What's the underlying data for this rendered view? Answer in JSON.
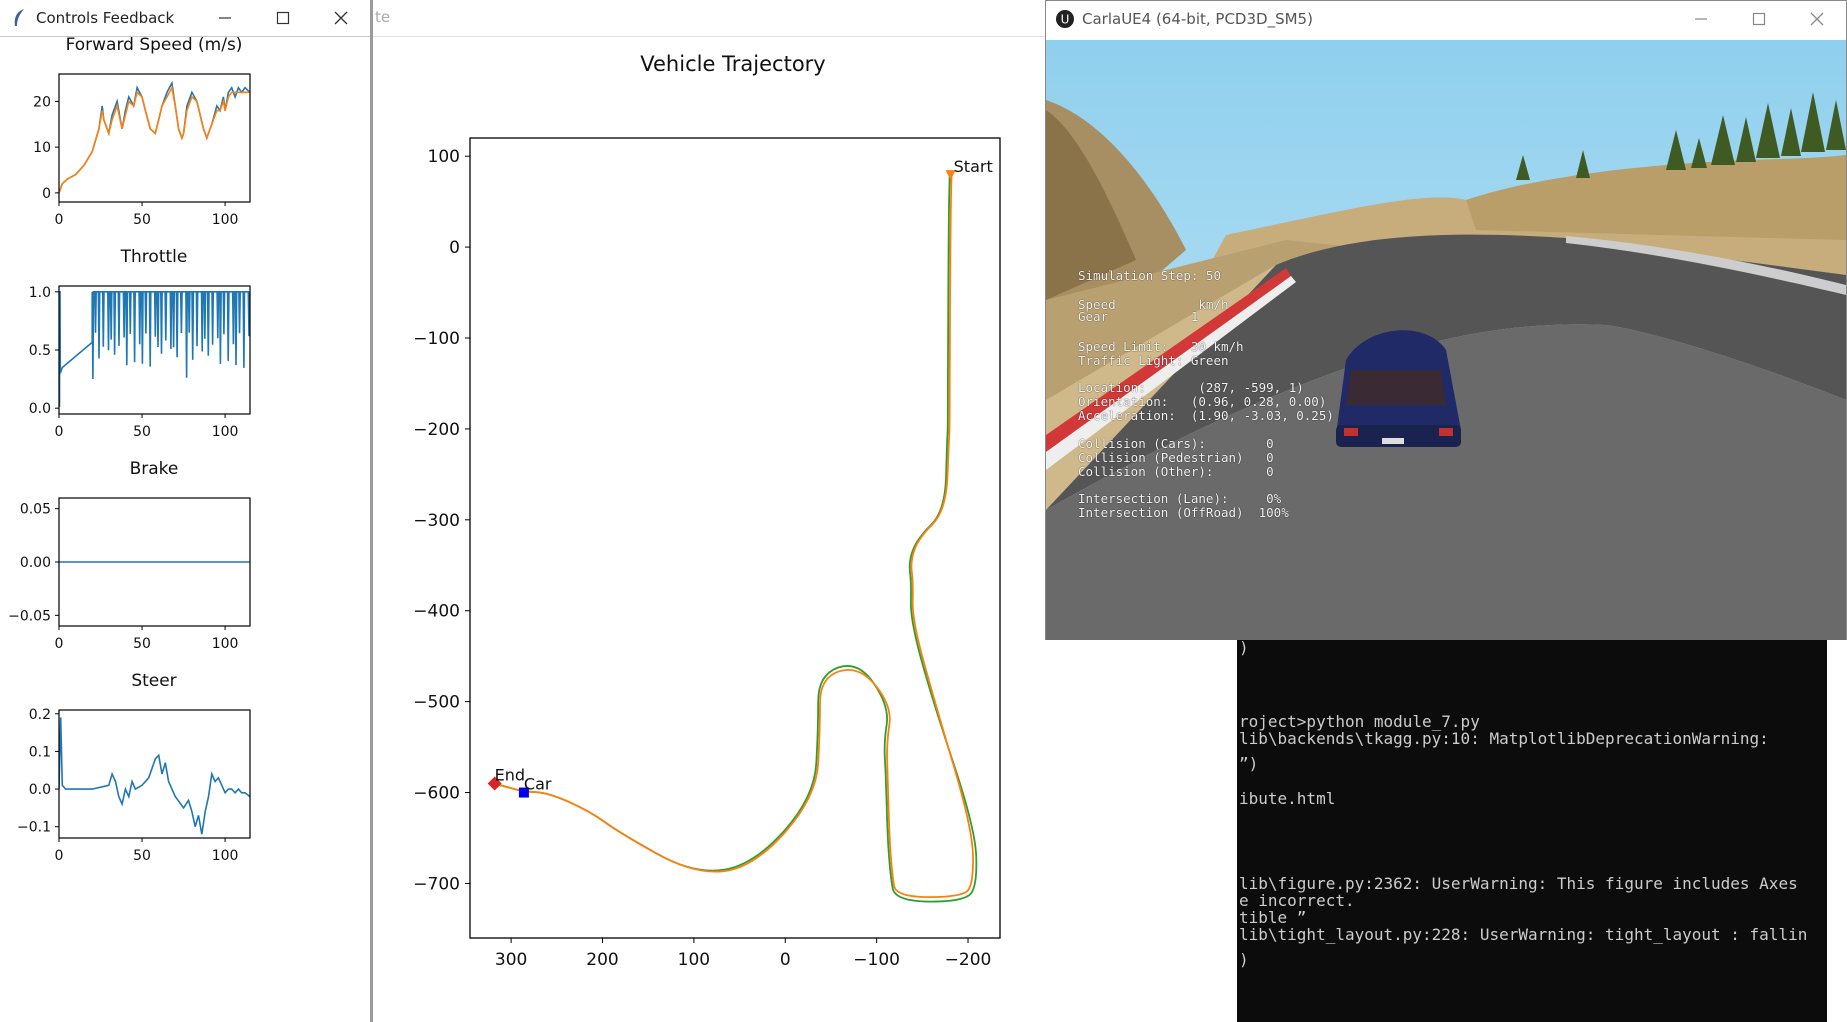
{
  "controls_window": {
    "title": "Controls Feedback",
    "icon": "feather-icon",
    "plots": [
      {
        "title": "Forward Speed (m/s)",
        "yticks": [
          "20",
          "10",
          "0"
        ],
        "xticks": [
          "0",
          "50",
          "100"
        ]
      },
      {
        "title": "Throttle",
        "yticks": [
          "1.0",
          "0.5",
          "0.0"
        ],
        "xticks": [
          "0",
          "50",
          "100"
        ]
      },
      {
        "title": "Brake",
        "yticks": [
          "0.05",
          "0.00",
          "−0.05"
        ],
        "xticks": [
          "0",
          "50",
          "100"
        ]
      },
      {
        "title": "Steer",
        "yticks": [
          "0.2",
          "0.1",
          "0.0",
          "−0.1"
        ],
        "xticks": [
          "0",
          "50",
          "100"
        ]
      }
    ]
  },
  "trajectory_window": {
    "hidden_title_fragment": "te",
    "title": "Vehicle Trajectory",
    "start_label": "Start",
    "end_label": "End",
    "car_label": "Car",
    "yticks": [
      "100",
      "0",
      "−100",
      "−200",
      "−300",
      "−400",
      "−500",
      "−600",
      "−700"
    ],
    "xticks": [
      "300",
      "200",
      "100",
      "0",
      "−100",
      "−200"
    ]
  },
  "carla_window": {
    "title": "CarlaUE4 (64-bit, PCD3D_SM5)",
    "icon": "unreal-engine-icon",
    "hud": [
      "Simulation Step: 50",
      "Speed           km/h",
      "Gear           1",
      "Speed Limit:   30 km/h",
      "Traffic Light: Green",
      "Location:       (287, -599, 1)",
      "Orientation:   (0.96, 0.28, 0.00)",
      "Acceleration:  (1.90, -3.03, 0.25)",
      "Collision (Cars):        0",
      "Collision (Pedestrian)   0",
      "Collision (Other):       0",
      "Intersection (Lane):     0%",
      "Intersection (OffRoad)  100%"
    ]
  },
  "terminal": {
    "lines": [
      ")",
      "roject>python module_7.py",
      "lib\\backends\\tkagg.py:10: MatplotlibDeprecationWarning:",
      "”)",
      "ibute.html",
      "lib\\figure.py:2362: UserWarning: This figure includes Axes",
      "e incorrect.",
      "tible ”",
      "lib\\tight_layout.py:228: UserWarning: tight_layout : fallin",
      ")"
    ]
  },
  "chart_data": [
    {
      "type": "line",
      "title": "Forward Speed (m/s)",
      "xlim": [
        0,
        115
      ],
      "ylim": [
        -2,
        26
      ],
      "series": [
        {
          "color": "#1f77b4",
          "x": [
            0,
            2,
            5,
            10,
            15,
            20,
            24,
            26,
            27,
            30,
            32,
            35,
            38,
            40,
            42,
            45,
            47,
            50,
            52,
            55,
            58,
            60,
            62,
            65,
            68,
            70,
            72,
            74,
            75,
            77,
            80,
            83,
            85,
            87,
            89,
            92,
            95,
            97,
            99,
            100,
            102,
            104,
            106,
            108,
            110,
            112,
            115
          ],
          "y": [
            0,
            2,
            3,
            4,
            6,
            9,
            14,
            19,
            16,
            13,
            17,
            20,
            14,
            18,
            21,
            19,
            23,
            21,
            18,
            14,
            13,
            16,
            19,
            22,
            24,
            19,
            14,
            12,
            13,
            19,
            22,
            20,
            17,
            14,
            12,
            15,
            19,
            18,
            21,
            18,
            22,
            23,
            21,
            23,
            22,
            23,
            22
          ]
        },
        {
          "color": "#ff7f0e",
          "x": [
            0,
            2,
            5,
            10,
            15,
            20,
            24,
            26,
            27,
            30,
            32,
            35,
            38,
            40,
            42,
            45,
            47,
            50,
            52,
            55,
            58,
            60,
            62,
            65,
            68,
            70,
            72,
            74,
            75,
            77,
            80,
            83,
            85,
            87,
            89,
            92,
            95,
            97,
            99,
            100,
            102,
            104,
            106,
            108,
            110,
            112,
            115
          ],
          "y": [
            0,
            2,
            3,
            4,
            6,
            9,
            14,
            18,
            16,
            13,
            16,
            19,
            14,
            17,
            20,
            19,
            22,
            21,
            18,
            14,
            13,
            16,
            19,
            21,
            23,
            19,
            14,
            12,
            13,
            18,
            21,
            20,
            17,
            14,
            12,
            15,
            18,
            18,
            20,
            18,
            21,
            22,
            22,
            22,
            22,
            22,
            22
          ]
        }
      ]
    },
    {
      "type": "line",
      "title": "Throttle",
      "xlim": [
        0,
        115
      ],
      "ylim": [
        -0.05,
        1.05
      ],
      "series": [
        {
          "color": "#1f77b4",
          "pattern": "throttle",
          "x": [
            0,
            115
          ],
          "y": [
            0,
            1
          ]
        }
      ]
    },
    {
      "type": "line",
      "title": "Brake",
      "xlim": [
        0,
        115
      ],
      "ylim": [
        -0.06,
        0.06
      ],
      "series": [
        {
          "color": "#1f77b4",
          "x": [
            0,
            115
          ],
          "y": [
            0,
            0
          ]
        }
      ]
    },
    {
      "type": "line",
      "title": "Steer",
      "xlim": [
        0,
        115
      ],
      "ylim": [
        -0.13,
        0.21
      ],
      "series": [
        {
          "color": "#1f77b4",
          "x": [
            0,
            1,
            2,
            4,
            10,
            20,
            30,
            32,
            34,
            36,
            38,
            40,
            42,
            44,
            46,
            50,
            54,
            58,
            60,
            62,
            64,
            66,
            70,
            75,
            78,
            80,
            82,
            84,
            86,
            88,
            90,
            92,
            94,
            96,
            98,
            100,
            102,
            104,
            106,
            108,
            110,
            112,
            115
          ],
          "y": [
            0,
            0.19,
            0.01,
            0.0,
            0.0,
            0.0,
            0.01,
            0.04,
            0.02,
            -0.02,
            -0.04,
            0.0,
            -0.02,
            0.02,
            0.0,
            0.01,
            0.03,
            0.08,
            0.09,
            0.04,
            0.07,
            0.02,
            -0.02,
            -0.05,
            -0.03,
            -0.06,
            -0.1,
            -0.07,
            -0.12,
            -0.06,
            -0.02,
            0.04,
            0.02,
            0.03,
            0.01,
            -0.01,
            0.0,
            0.0,
            -0.01,
            0.0,
            -0.01,
            -0.01,
            -0.02
          ]
        }
      ]
    },
    {
      "type": "line",
      "title": "Vehicle Trajectory",
      "xlim": [
        345,
        -235
      ],
      "ylim": [
        -760,
        120
      ],
      "series": [
        {
          "color": "#2ca02c",
          "x": [
            -180,
            -179,
            -178,
            -178,
            -177,
            -175,
            -145,
            -135,
            -138,
            -137,
            -160,
            -208,
            -210,
            -198,
            -120,
            -115,
            -112,
            -110,
            -108,
            -114,
            -80,
            -36,
            -36,
            -32,
            35,
            100,
            180,
            215,
            260,
            287,
            300,
            320
          ],
          "y": [
            80,
            40,
            -100,
            -200,
            -213,
            -290,
            -320,
            -345,
            -370,
            -410,
            -495,
            -640,
            -700,
            -720,
            -720,
            -690,
            -650,
            -580,
            -545,
            -505,
            -455,
            -470,
            -530,
            -605,
            -680,
            -690,
            -645,
            -620,
            -600,
            -599,
            -595,
            -590
          ]
        },
        {
          "color": "#ff7f0e",
          "x": [
            -182,
            -181,
            -180,
            -180,
            -179,
            -176,
            -146,
            -137,
            -140,
            -139,
            -162,
            -205,
            -206,
            -194,
            -121,
            -117,
            -114,
            -112,
            -111,
            -117,
            -81,
            -38,
            -38,
            -34,
            35,
            100,
            180,
            215,
            260,
            287,
            300,
            320
          ],
          "y": [
            80,
            40,
            -100,
            -200,
            -213,
            -290,
            -320,
            -345,
            -370,
            -410,
            -495,
            -640,
            -700,
            -715,
            -715,
            -690,
            -650,
            -580,
            -545,
            -505,
            -460,
            -473,
            -530,
            -605,
            -683,
            -690,
            -645,
            -620,
            -600,
            -599,
            -595,
            -590
          ]
        }
      ]
    }
  ]
}
